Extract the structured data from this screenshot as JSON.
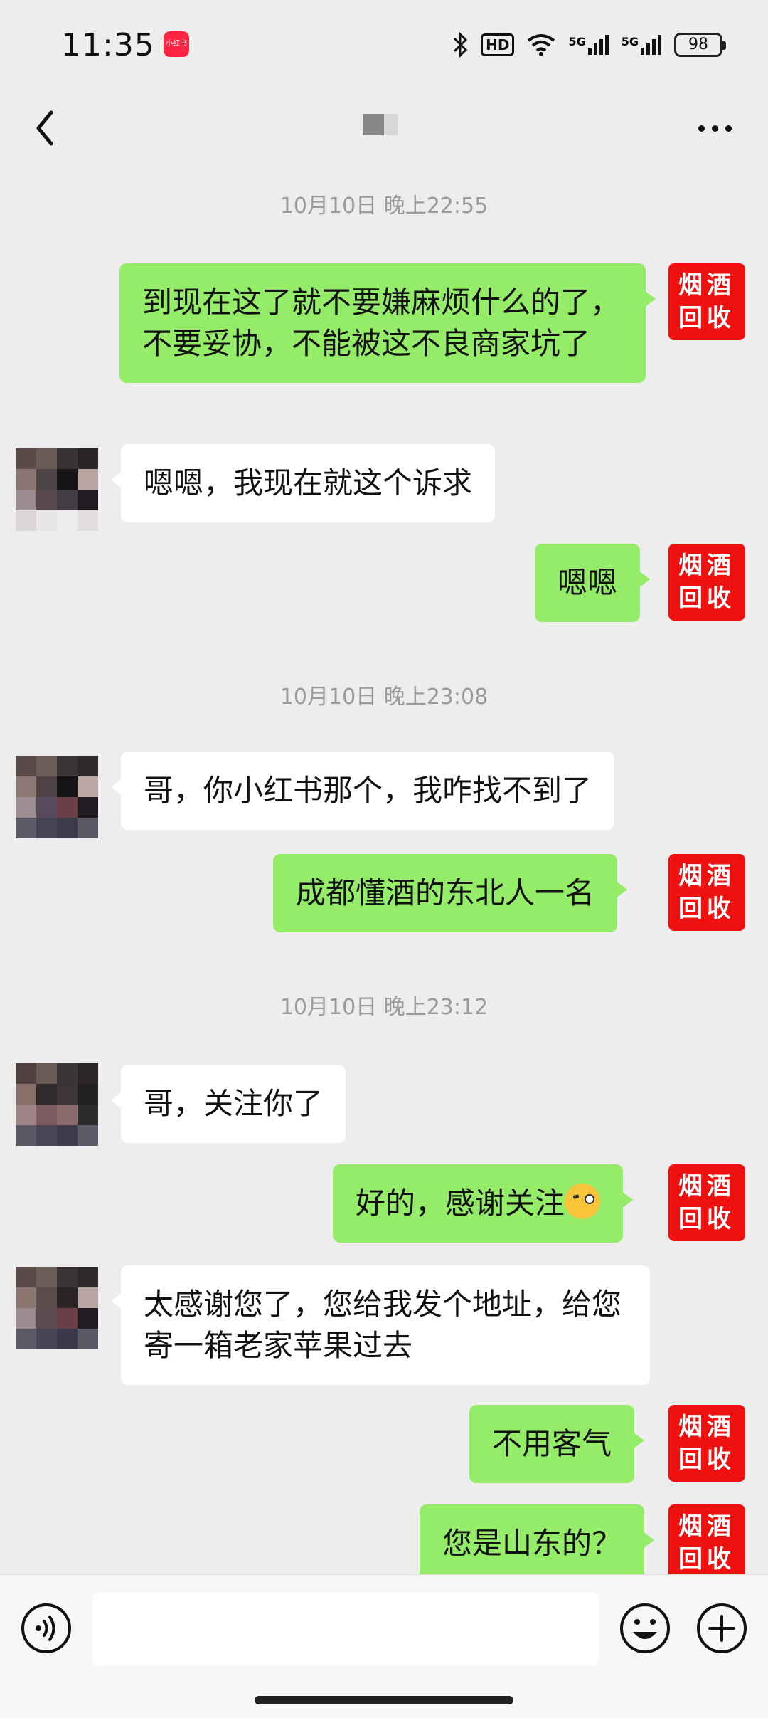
{
  "status_bar": {
    "time": "11:35",
    "app_badge": "小红书",
    "hd_label": "HD",
    "network_1": "5G",
    "network_2": "5G",
    "battery": "98"
  },
  "header": {
    "back_icon": "chevron-left-icon",
    "title_redacted": true,
    "more_icon": "more-horizontal-icon"
  },
  "my_avatar": {
    "line1": "烟酒",
    "line2": "回收",
    "color": "#ef1010"
  },
  "timestamps": {
    "t1": "10月10日 晚上22:55",
    "t2": "10月10日 晚上23:08",
    "t3": "10月10日 晚上23:12"
  },
  "messages": {
    "m1": {
      "sender": "me",
      "text": "到现在这了就不要嫌麻烦什么的了，不要妥协，不能被这不良商家坑了"
    },
    "m2": {
      "sender": "other",
      "text": "嗯嗯，我现在就这个诉求"
    },
    "m3": {
      "sender": "me",
      "text": "嗯嗯"
    },
    "m4": {
      "sender": "other",
      "text": "哥，你小红书那个，我咋找不到了"
    },
    "m5": {
      "sender": "me",
      "text": "成都懂酒的东北人一名"
    },
    "m6": {
      "sender": "other",
      "text": "哥，关注你了"
    },
    "m7": {
      "sender": "me",
      "text": "好的，感谢关注"
    },
    "m8": {
      "sender": "other",
      "text": "太感谢您了，您给我发个地址，给您寄一箱老家苹果过去"
    },
    "m9": {
      "sender": "me",
      "text": "不用客气"
    },
    "m10": {
      "sender": "me",
      "text": "您是山东的？"
    }
  },
  "input_bar": {
    "voice_icon": "voice-icon",
    "input_placeholder": "",
    "emoji_icon": "emoji-icon",
    "plus_icon": "plus-icon"
  },
  "colors": {
    "background": "#ededed",
    "my_bubble": "#95ec69",
    "other_bubble": "#ffffff",
    "timestamp_text": "#9a9a9a"
  }
}
